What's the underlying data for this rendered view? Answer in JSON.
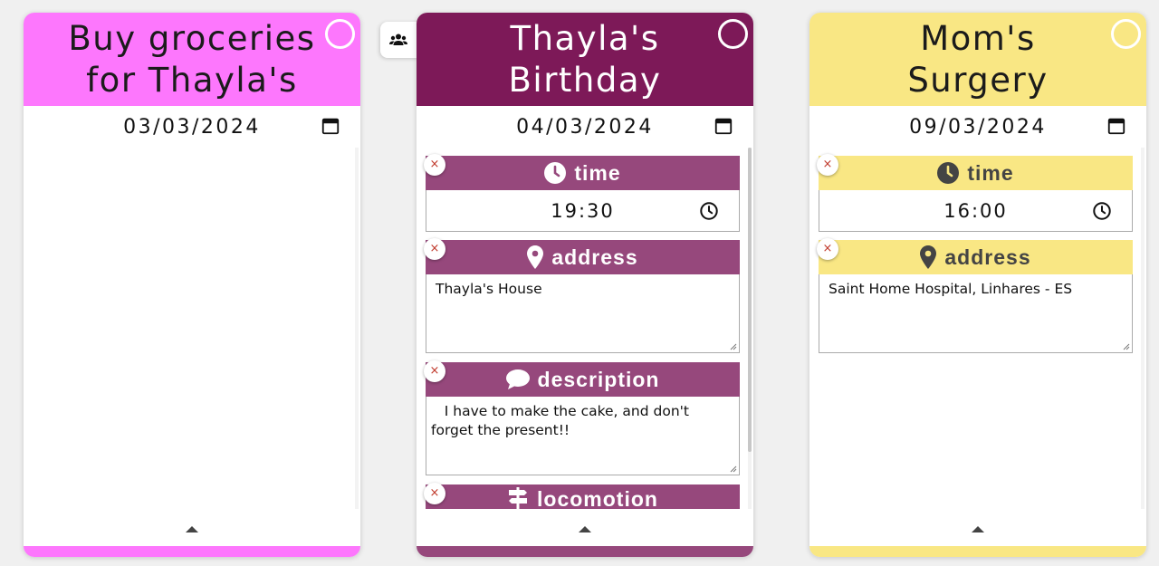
{
  "cards": [
    {
      "title_line1": "Buy groceries",
      "title_line2": "for Thayla's",
      "date": "03/03/2024",
      "colors": {
        "header": "#fd77fd",
        "header_text": "#1b1b1b",
        "bar": "#fd77fd"
      }
    },
    {
      "title_line1": "Thayla's",
      "title_line2": "Birthday",
      "date": "04/03/2024",
      "colors": {
        "header": "#7d1958",
        "header_text": "#ffffff",
        "field_head": "#96487c",
        "bar": "#96487c"
      },
      "fields": {
        "time": {
          "label": "time",
          "value": "19:30"
        },
        "address": {
          "label": "address",
          "value": "Thayla's House"
        },
        "description": {
          "label": "description",
          "value": "   I have to make the cake, and don't forget the present!!"
        },
        "locomotion": {
          "label": "locomotion"
        }
      }
    },
    {
      "title_line1": "Mom's",
      "title_line2": "Surgery",
      "date": "09/03/2024",
      "colors": {
        "header": "#f9e784",
        "header_text": "#1b1b1b",
        "field_head": "#f9e784",
        "field_text": "#444444",
        "bar": "#f9e784"
      },
      "fields": {
        "time": {
          "label": "time",
          "value": "16:00"
        },
        "address": {
          "label": "address",
          "value": "Saint Home Hospital, Linhares - ES"
        }
      }
    }
  ],
  "icons": {
    "remove": "×",
    "share": "users-icon",
    "calendar": "calendar-icon",
    "clock": "clock-icon",
    "time": "clock-filled-icon",
    "address": "map-pin-icon",
    "description": "comment-icon",
    "locomotion": "signs-icon",
    "expand": "caret-up-icon"
  }
}
